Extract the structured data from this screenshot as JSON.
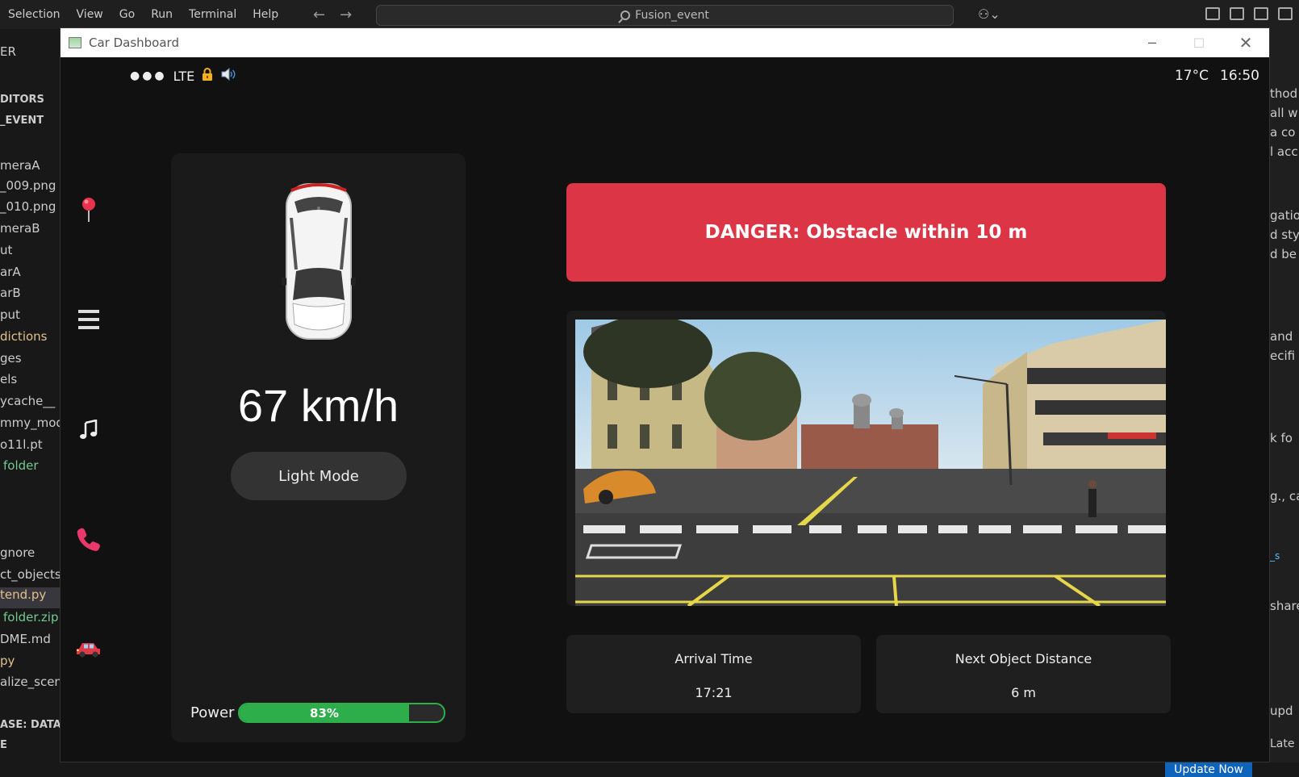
{
  "vscode": {
    "menu": [
      "Selection",
      "View",
      "Go",
      "Run",
      "Terminal",
      "Help"
    ],
    "search_text": "Fusion_event",
    "explorer": [
      "ER",
      "DITORS",
      "_EVENT",
      "meraA",
      "_009.png",
      "_010.png",
      "meraB",
      "ut",
      "arA",
      "arB",
      "put",
      "dictions",
      "ges",
      "els",
      "ycache__",
      "mmy_mode",
      "o11l.pt",
      "folder",
      "gnore",
      "ct_objects.",
      "tend.py",
      "folder.zip",
      "DME.md",
      "py",
      "alize_scene",
      "ASE: DATAB",
      "E"
    ],
    "right_fragments": [
      "thod",
      "all w",
      "a co",
      "l acc",
      "gatio",
      "d styl",
      "d be",
      "and",
      "ecifi",
      "k fo",
      "g., ca",
      "_s",
      "share",
      "upd",
      "Late"
    ],
    "update_button": "Update Now"
  },
  "window": {
    "title": "Car Dashboard",
    "controls": [
      "minimize",
      "maximize",
      "close"
    ]
  },
  "status": {
    "dots": "●●●",
    "network": "LTE",
    "lock_icon": "lock-icon",
    "sound_icon": "speaker-icon",
    "temperature": "17°C",
    "time": "16:50"
  },
  "sidebar": {
    "icons": [
      "map-pin-icon",
      "menu-icon",
      "music-icon",
      "phone-icon",
      "car-icon"
    ]
  },
  "car_panel": {
    "speed": "67 km/h",
    "mode_button": "Light Mode",
    "power_label": "Power",
    "power_value": "83%",
    "power_fraction": 0.83
  },
  "alert": {
    "text": "DANGER: Obstacle within 10 m",
    "color": "#dc3545"
  },
  "info_cards": [
    {
      "title": "Arrival Time",
      "value": "17:21"
    },
    {
      "title": "Next Object Distance",
      "value": "6 m"
    }
  ],
  "colors": {
    "background": "#111111",
    "panel": "#1a1a1a",
    "power": "#2eae4b",
    "danger": "#dc3545"
  }
}
